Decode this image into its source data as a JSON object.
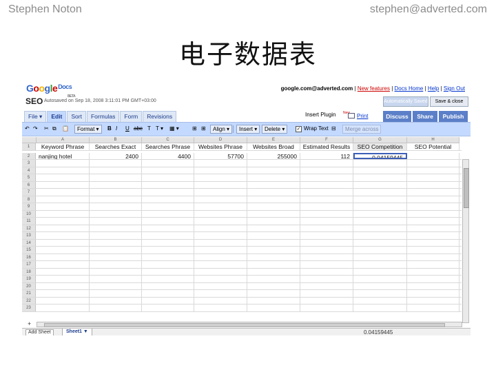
{
  "slide": {
    "author": "Stephen Noton",
    "email": "stephen@adverted.com",
    "title": "电子数据表"
  },
  "app": {
    "logo_text": "Google",
    "logo_product": "Docs",
    "logo_beta": "BETA",
    "doc_title": "SEO",
    "autosaved": "Autosaved on Sep 18, 2008 3:11:01 PM GMT+03:00"
  },
  "top_links": {
    "account": "google.com@adverted.com",
    "new_features": "New features",
    "docs_home": "Docs Home",
    "help": "Help",
    "sign_out": "Sign Out",
    "separator": "|"
  },
  "buttons": {
    "autosave": "Automatically Saved",
    "save_close": "Save & close",
    "discuss": "Discuss",
    "share": "Share",
    "publish": "Publish",
    "insert_plugin": "Insert Plugin",
    "new_badge": "New",
    "print": "Print"
  },
  "tabs": [
    "File ▾",
    "Edit",
    "Sort",
    "Formulas",
    "Form",
    "Revisions"
  ],
  "active_tab": "Edit",
  "toolbar": {
    "undo": "↶",
    "redo": "↷",
    "cut": "✂",
    "copy": "⧉",
    "paste": "📋",
    "format": "Format ▾",
    "bold": "B",
    "italic": "I",
    "underline": "U",
    "strike": "abc",
    "font": "T",
    "text_color": "T ▾",
    "fill": "▦ ▾",
    "borders": "⊞",
    "align": "Align ▾",
    "insert": "Insert ▾",
    "delete": "Delete ▾",
    "wrap_text": "Wrap Text",
    "wrap_checked": true,
    "merge_icon": "⊟",
    "merge_across": "Merge across"
  },
  "sheet": {
    "columns": [
      "A",
      "B",
      "C",
      "D",
      "E",
      "F",
      "G",
      "H"
    ],
    "header_row": [
      "Keyword Phrase",
      "Searches Exact",
      "Searches Phrase",
      "Websites Phrase",
      "Websites Broad",
      "Estimated Results",
      "SEO Competition",
      "SEO Potential"
    ],
    "data_rows": [
      [
        "nanjing hotel",
        "2400",
        "4400",
        "57700",
        "255000",
        "112",
        "0.04159445",
        ""
      ]
    ],
    "row_numbers": [
      "1",
      "2",
      "3",
      "4",
      "5",
      "6",
      "7",
      "8",
      "9",
      "10",
      "11",
      "12",
      "13",
      "14",
      "15",
      "16",
      "17",
      "18",
      "19",
      "20",
      "21",
      "22",
      "23"
    ],
    "selected_cell": "G2"
  },
  "bottom": {
    "plus": "+",
    "add_sheet": "Add Sheet",
    "sheet_tab": "Sheet1 ▼",
    "status_value": "0.04159445"
  },
  "colors": {
    "toolbar_bg": "#c3d9ff",
    "action_button": "#5b7fc8",
    "link": "#0033cc",
    "new_features": "#cc0000",
    "selection": "#3b5eb7"
  }
}
